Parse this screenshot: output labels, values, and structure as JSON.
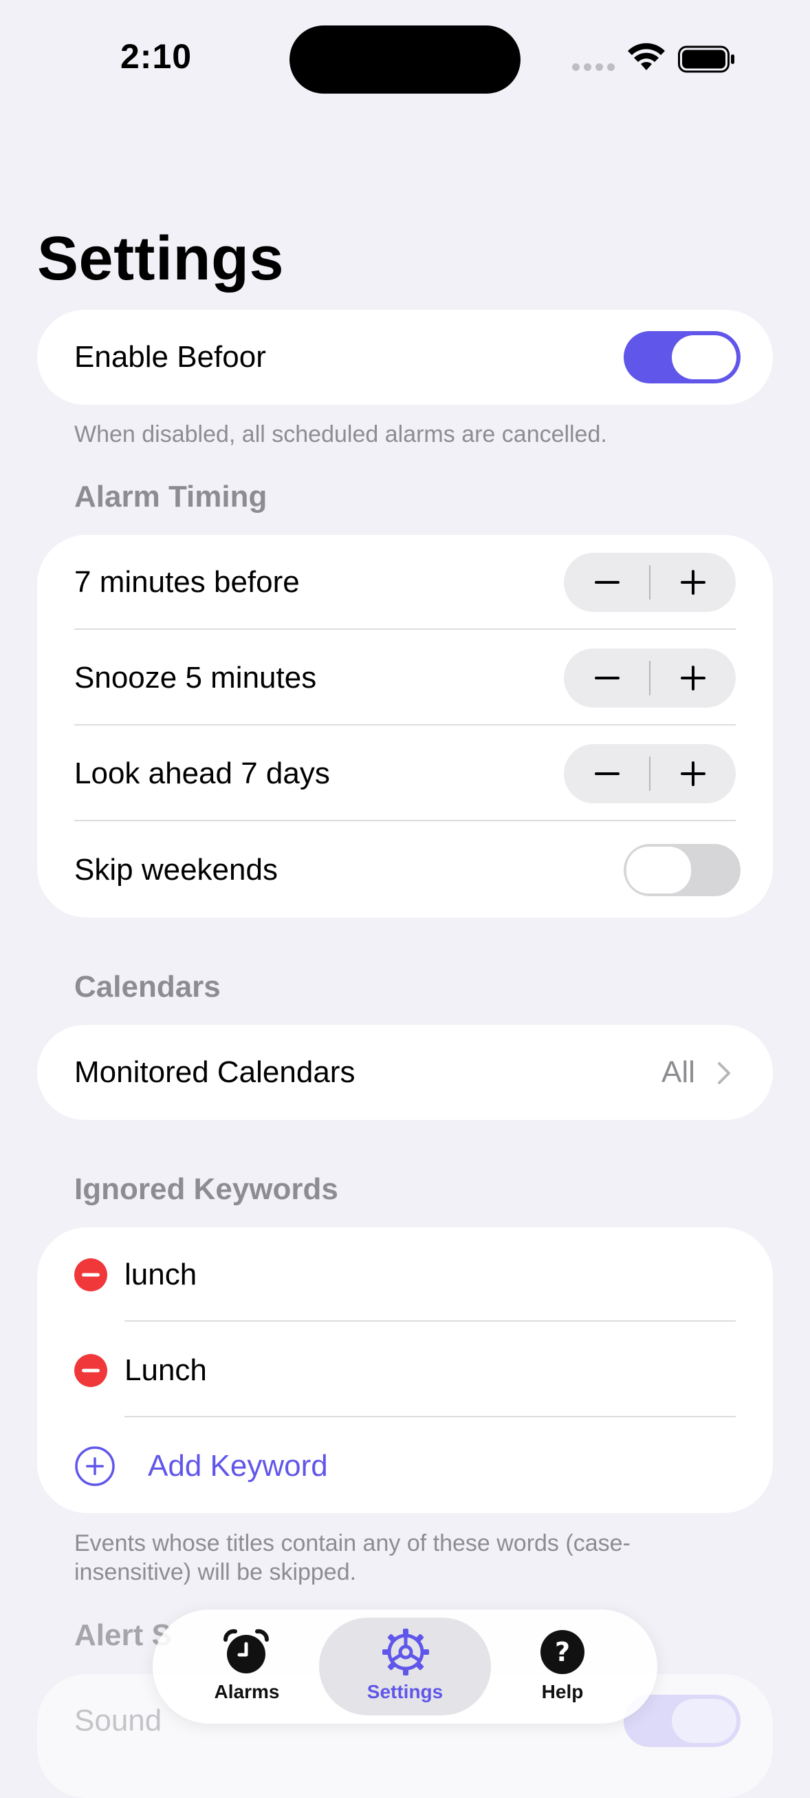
{
  "status_bar": {
    "time": "2:10"
  },
  "page": {
    "title": "Settings"
  },
  "enable": {
    "label": "Enable Befoor",
    "enabled": true,
    "footnote": "When disabled, all scheduled alarms are cancelled."
  },
  "alarm_timing": {
    "header": "Alarm Timing",
    "rows": [
      {
        "label": "7 minutes before"
      },
      {
        "label": "Snooze 5 minutes"
      },
      {
        "label": "Look ahead 7 days"
      }
    ],
    "skip_weekends": {
      "label": "Skip weekends",
      "enabled": false
    }
  },
  "calendars": {
    "header": "Calendars",
    "monitored": {
      "label": "Monitored Calendars",
      "value": "All"
    }
  },
  "ignored_keywords": {
    "header": "Ignored Keywords",
    "items": [
      {
        "label": "lunch"
      },
      {
        "label": "Lunch"
      }
    ],
    "add_label": "Add Keyword",
    "footnote_line1": "Events whose titles contain any of these words (case-",
    "footnote_line2": "insensitive) will be skipped."
  },
  "alert_sound": {
    "header_partial": "Alert S",
    "sound_label": "Sound"
  },
  "tab_bar": {
    "tabs": [
      {
        "label": "Alarms",
        "icon": "alarm-clock-icon",
        "selected": false
      },
      {
        "label": "Settings",
        "icon": "gear-icon",
        "selected": true
      },
      {
        "label": "Help",
        "icon": "question-circle-icon",
        "selected": false
      }
    ]
  },
  "colors": {
    "accent": "#6056ea",
    "background": "#f2f1f7",
    "destructive": "#f0383b",
    "secondary_text": "#8c8c91"
  }
}
